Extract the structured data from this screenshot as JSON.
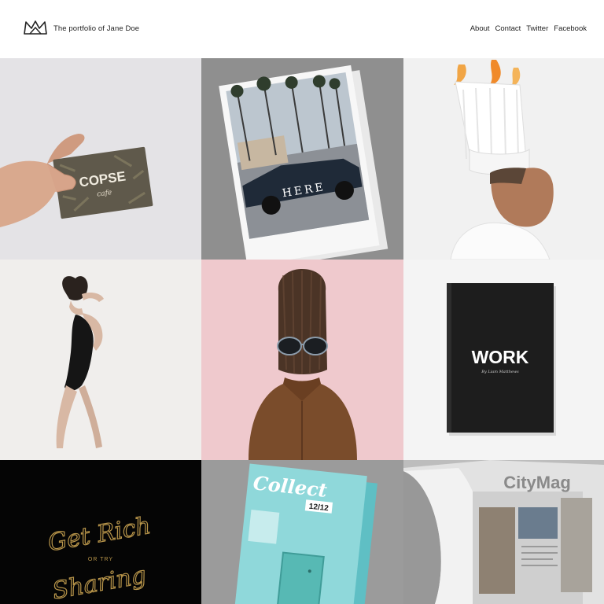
{
  "header": {
    "site_title": "The portfolio of Jane Doe",
    "logo_icon": "crown-icon"
  },
  "nav": {
    "items": [
      {
        "label": "About"
      },
      {
        "label": "Contact"
      },
      {
        "label": "Twitter"
      },
      {
        "label": "Facebook"
      }
    ]
  },
  "projects": [
    {
      "text": "COPSE",
      "subtext": "cafe",
      "bg": "#e4e3e6"
    },
    {
      "text": "HERE",
      "bg": "#8f8f8f"
    },
    {
      "bg": "#f1f1f1"
    },
    {
      "bg": "#f0eeec"
    },
    {
      "bg": "#efc9cd"
    },
    {
      "text": "WORK",
      "subtext": "By Liam Matthews",
      "bg": "#f4f4f4"
    },
    {
      "line1": "Get Rich",
      "line2": "OR TRY",
      "line3": "Sharing",
      "bg": "#050505"
    },
    {
      "text": "Collect",
      "subtext": "12/12",
      "bg": "#9b9b9b"
    },
    {
      "text": "CityMag",
      "bg": "#bdbdbd"
    }
  ]
}
